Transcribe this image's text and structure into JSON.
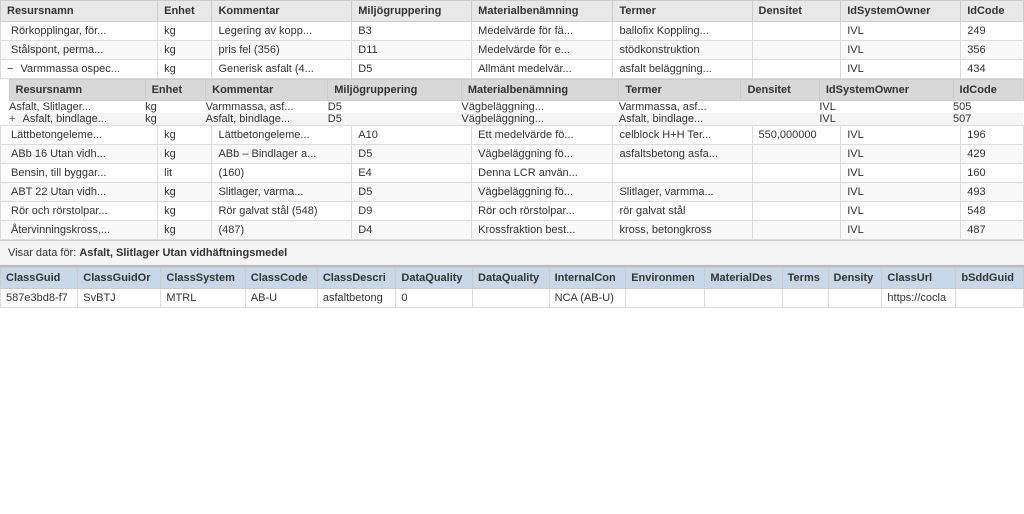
{
  "mainTable": {
    "headers": [
      "Resursnamn",
      "Enhet",
      "Kommentar",
      "Miljögruppering",
      "Materialbenämning",
      "Termer",
      "Densitet",
      "IdSystemOwner",
      "IdCode"
    ],
    "rows": [
      {
        "id": "row1",
        "cells": [
          "Rörkopplingar, för...",
          "kg",
          "Legering av kopp...",
          "B3",
          "Medelvärde för fä...",
          "ballofix Koppling...",
          "",
          "IVL",
          "249"
        ],
        "expanded": false
      },
      {
        "id": "row2",
        "cells": [
          "Stålspont, perma...",
          "kg",
          "pris fel (356)",
          "D11",
          "Medelvärde för e...",
          "stödkonstruktion",
          "",
          "IVL",
          "356"
        ],
        "expanded": false
      },
      {
        "id": "row3",
        "cells": [
          "Varmmassa ospec...",
          "kg",
          "Generisk asfalt (4...",
          "D5",
          "Allmänt medelvär...",
          "asfalt beläggning...",
          "",
          "IVL",
          "434"
        ],
        "expanded": true,
        "expandIcon": "−",
        "subTable": {
          "headers": [
            "Resursnamn",
            "Enhet",
            "Kommentar",
            "Miljögruppering",
            "Materialbenämning",
            "Termer",
            "Densitet",
            "IdSystemOwner",
            "IdCode"
          ],
          "rows": [
            {
              "cells": [
                "Asfalt, Slitlager...",
                "kg",
                "Varmmassa, asf...",
                "D5",
                "Vägbeläggning...",
                "Varmmassa, asf...",
                "",
                "IVL",
                "505"
              ],
              "hasPlus": false
            },
            {
              "cells": [
                "Asfalt, bindlage...",
                "kg",
                "Asfalt, bindlage...",
                "D5",
                "Vägbeläggning...",
                "Asfalt, bindlage...",
                "",
                "IVL",
                "507"
              ],
              "hasPlus": true
            }
          ]
        }
      },
      {
        "id": "row4",
        "cells": [
          "Lättbetongeleme...",
          "kg",
          "Lättbetongeleme...",
          "A10",
          "Ett medelvärde fö...",
          "celblock H+H Ter...",
          "550,000000",
          "IVL",
          "196"
        ],
        "expanded": false
      },
      {
        "id": "row5",
        "cells": [
          "ABb 16 Utan vidh...",
          "kg",
          "ABb – Bindlager a...",
          "D5",
          "Vägbeläggning fö...",
          "asfaltsbetong asfa...",
          "",
          "IVL",
          "429"
        ],
        "expanded": false
      },
      {
        "id": "row6",
        "cells": [
          "Bensin, till byggar...",
          "lit",
          "(160)",
          "E4",
          "Denna LCR använ...",
          "",
          "",
          "IVL",
          "160"
        ],
        "expanded": false
      },
      {
        "id": "row7",
        "cells": [
          "ABT 22 Utan vidh...",
          "kg",
          "Slitlager, varma...",
          "D5",
          "Vägbeläggning fö...",
          "Slitlager, varmma...",
          "",
          "IVL",
          "493"
        ],
        "expanded": false
      },
      {
        "id": "row8",
        "cells": [
          "Rör och rörstolpar...",
          "kg",
          "Rör galvat stål (548)",
          "D9",
          "Rör och rörstolpar...",
          "rör galvat stål",
          "",
          "IVL",
          "548"
        ],
        "expanded": false
      },
      {
        "id": "row9",
        "cells": [
          "Återvinningskross,...",
          "kg",
          "(487)",
          "D4",
          "Krossfraktion best...",
          "kross, betongkross",
          "",
          "IVL",
          "487"
        ],
        "expanded": false
      }
    ]
  },
  "statusBar": {
    "prefix": "Visar data för:",
    "value": "Asfalt, Slitlager Utan vidhäftningsmedel"
  },
  "bottomTable": {
    "headers": [
      "ClassGuid",
      "ClassGuidOr",
      "ClassSystem",
      "ClassCode",
      "ClassDescri",
      "DataQuality",
      "DataQuality",
      "InternalCon",
      "Environmen",
      "MaterialDes",
      "Terms",
      "Density",
      "ClassUrl",
      "bSddGuid"
    ],
    "rows": [
      {
        "cells": [
          "587e3bd8-f7",
          "SvBTJ",
          "MTRL",
          "AB-U",
          "asfaltbetong",
          "0",
          "",
          "NCA (AB-U)",
          "",
          "",
          "",
          "",
          "https://cocla",
          ""
        ]
      }
    ]
  }
}
